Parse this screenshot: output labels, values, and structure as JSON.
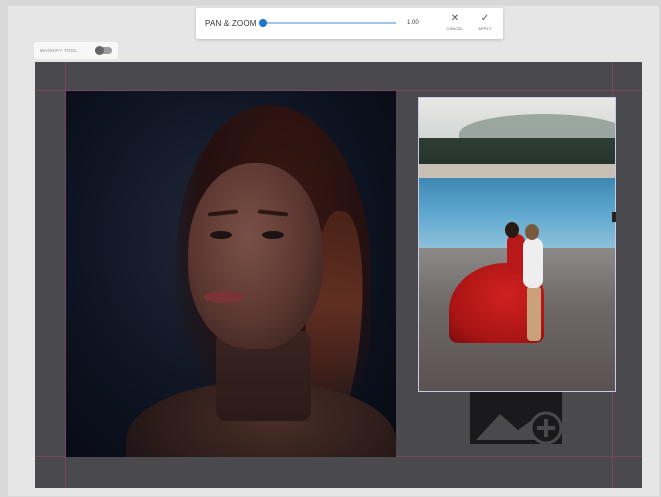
{
  "toolbar": {
    "title": "PAN & ZOOM",
    "zoom_value": "1.00",
    "zoom_fraction": 0.0,
    "cancel_label": "CANCEL",
    "apply_label": "APPLY",
    "cancel_icon": "close-icon",
    "apply_icon": "check-icon"
  },
  "magnify": {
    "label": "MAGNIFY TOOL",
    "enabled": false
  },
  "canvas": {
    "background": "#4a4a4e",
    "guide_color": "#8a4466"
  },
  "placeholders": {
    "add_image_icon": "add-image-icon"
  },
  "colors": {
    "accent": "#1f74d1",
    "track": "#9ec4ee"
  }
}
